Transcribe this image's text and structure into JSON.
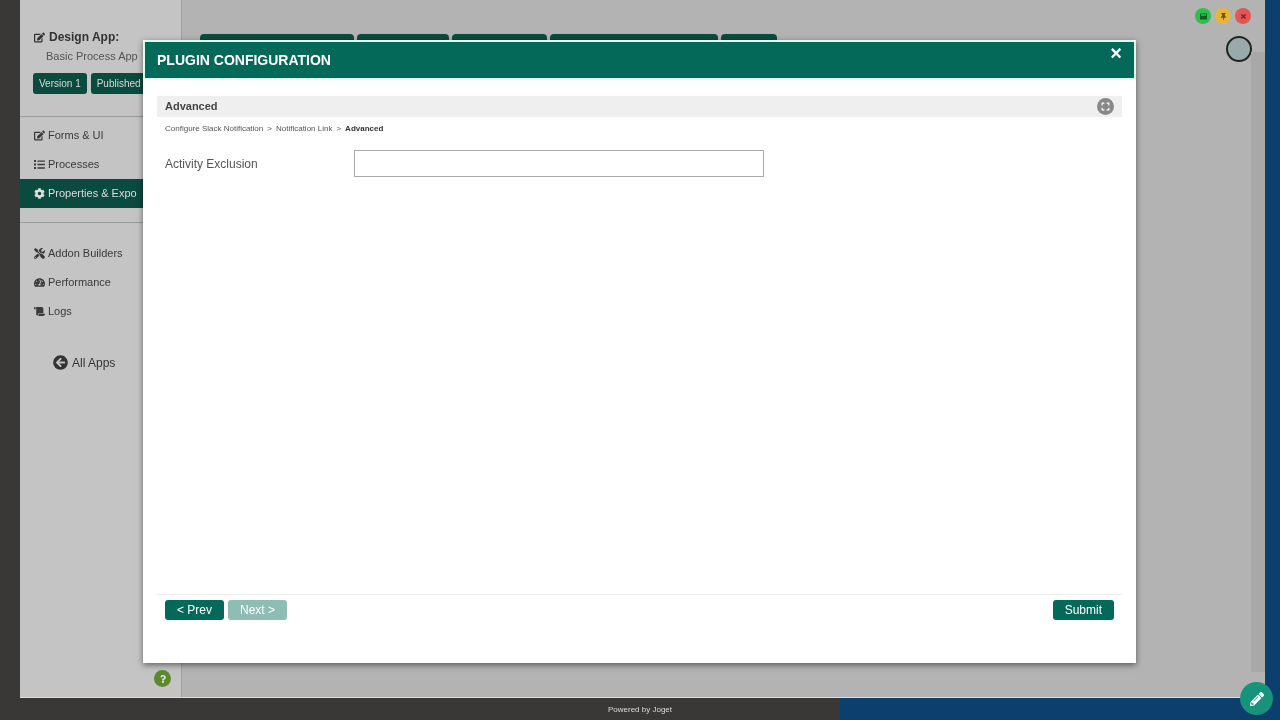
{
  "sidebar": {
    "heading": "Design App:",
    "app_name": "Basic Process App",
    "badges": [
      "Version 1",
      "Published"
    ],
    "items": [
      {
        "label": "Forms & UI",
        "selected": false
      },
      {
        "label": "Processes",
        "selected": false
      },
      {
        "label": "Properties & Expo",
        "selected": true
      },
      {
        "label": "Addon Builders",
        "selected": false
      },
      {
        "label": "Performance",
        "selected": false
      },
      {
        "label": "Logs",
        "selected": false
      }
    ],
    "all_apps": "All Apps"
  },
  "modal": {
    "title": "PLUGIN CONFIGURATION",
    "close": "×",
    "section": "Advanced",
    "breadcrumb": [
      {
        "label": "Configure Slack Notification",
        "current": false
      },
      {
        "label": "Notification Link",
        "current": false
      },
      {
        "label": "Advanced",
        "current": true
      }
    ],
    "breadcrumb_separator": ">",
    "fields": [
      {
        "label": "Activity Exclusion"
      }
    ],
    "buttons": [
      {
        "label": "< Prev",
        "disabled": false,
        "kind": "nav"
      },
      {
        "label": "Next >",
        "disabled": true,
        "kind": "nav"
      },
      {
        "label": "Submit",
        "disabled": false,
        "kind": "submit"
      }
    ]
  },
  "footer": "Powered by Joget"
}
